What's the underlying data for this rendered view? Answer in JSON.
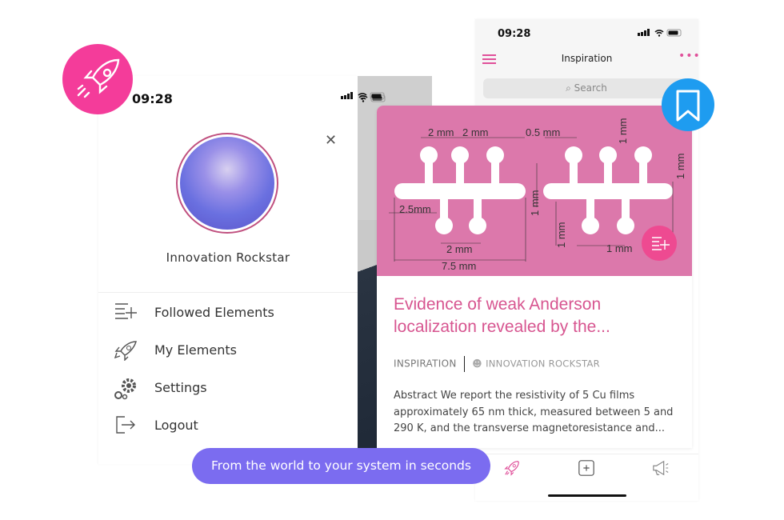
{
  "colors": {
    "accent_pink": "#f43c9a",
    "title_pink": "#d75590",
    "card_image": "#dc78ab",
    "bookmark_blue": "#1e9cf0",
    "pill_purple": "#7b6cf0"
  },
  "back_phone": {
    "status_time": "09:28",
    "header_title": "Inspiration",
    "search_placeholder": "Search",
    "tabs": [
      {
        "icon": "rocket-icon"
      },
      {
        "icon": "plus-square-icon"
      },
      {
        "icon": "megaphone-icon"
      }
    ]
  },
  "drawer": {
    "status_time": "09:28",
    "user_name": "Innovation Rockstar",
    "menu": [
      {
        "label": "Followed Elements",
        "icon": "followed-list-icon"
      },
      {
        "label": "My Elements",
        "icon": "rocket-icon"
      },
      {
        "label": "Settings",
        "icon": "gears-icon"
      },
      {
        "label": "Logout",
        "icon": "logout-icon"
      }
    ]
  },
  "card": {
    "diagram_labels": [
      "2 mm",
      "2 mm",
      "0.5 mm",
      "1 mm",
      "1 mm",
      "2.5mm",
      "1 mm",
      "1 mm",
      "2 mm",
      "1 mm",
      "7.5 mm"
    ],
    "title": "Evidence of weak Anderson localization revealed by the...",
    "category": "INSPIRATION",
    "author": "INNOVATION ROCKSTAR",
    "abstract": "Abstract We report the resistivity of 5 Cu films approximately 65 nm thick, measured between 5 and 290 K, and the transverse magnetoresistance and..."
  },
  "tagline": "From the world to your system in seconds"
}
